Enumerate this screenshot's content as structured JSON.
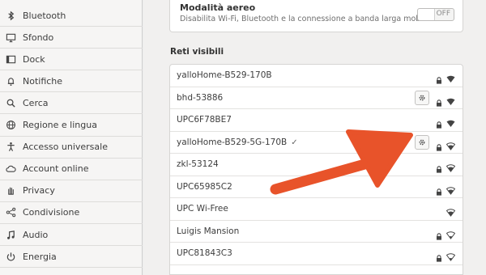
{
  "sidebar": {
    "items": [
      {
        "label": "Bluetooth",
        "icon": "bluetooth-icon"
      },
      {
        "label": "Sfondo",
        "icon": "monitor-icon"
      },
      {
        "label": "Dock",
        "icon": "dock-icon"
      },
      {
        "label": "Notifiche",
        "icon": "bell-icon"
      },
      {
        "label": "Cerca",
        "icon": "search-icon"
      },
      {
        "label": "Regione e lingua",
        "icon": "globe-icon"
      },
      {
        "label": "Accesso universale",
        "icon": "accessibility-icon"
      },
      {
        "label": "Account online",
        "icon": "cloud-icon"
      },
      {
        "label": "Privacy",
        "icon": "hand-icon"
      },
      {
        "label": "Condivisione",
        "icon": "share-icon"
      },
      {
        "label": "Audio",
        "icon": "music-note-icon"
      },
      {
        "label": "Energia",
        "icon": "power-icon"
      }
    ]
  },
  "airplane": {
    "title": "Modalità aereo",
    "subtitle": "Disabilita Wi-Fi, Bluetooth e la connessione a banda larga mobile",
    "toggle_state": "OFF"
  },
  "networks": {
    "section_title": "Reti visibili",
    "items": [
      {
        "name": "yalloHome-B529-170B",
        "connected": false,
        "gear": false,
        "secured": true,
        "signal": "full"
      },
      {
        "name": "bhd-53886",
        "connected": false,
        "gear": true,
        "secured": true,
        "signal": "full"
      },
      {
        "name": "UPC6F78BE7",
        "connected": false,
        "gear": false,
        "secured": true,
        "signal": "full"
      },
      {
        "name": "yalloHome-B529-5G-170B",
        "connected": true,
        "check": "✓",
        "gear": true,
        "secured": true,
        "signal": "good"
      },
      {
        "name": "zkl-53124",
        "connected": false,
        "gear": false,
        "secured": true,
        "signal": "good"
      },
      {
        "name": "UPC65985C2",
        "connected": false,
        "gear": false,
        "secured": true,
        "signal": "good"
      },
      {
        "name": "UPC Wi-Free",
        "connected": false,
        "gear": false,
        "secured": false,
        "signal": "good"
      },
      {
        "name": "Luigis Mansion",
        "connected": false,
        "gear": false,
        "secured": true,
        "signal": "weak"
      },
      {
        "name": "UPC81843C3",
        "connected": false,
        "gear": false,
        "secured": true,
        "signal": "weak"
      }
    ]
  },
  "colors": {
    "annotation_arrow": "#e8532a"
  }
}
